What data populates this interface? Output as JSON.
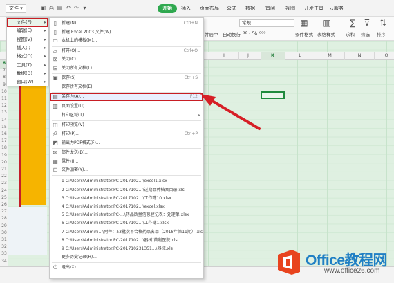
{
  "topbar": {
    "file_label": "文件",
    "tabs": [
      "开始",
      "插入",
      "页面布局",
      "公式",
      "数据",
      "审阅",
      "视图",
      "开发工具",
      "云服务"
    ]
  },
  "ribbon": {
    "number_format": "常规",
    "labels": [
      "并居中",
      "自动换行",
      "条件格式",
      "表格样式",
      "求和",
      "筛选",
      "排序"
    ]
  },
  "columns": [
    "I",
    "J",
    "K",
    "L",
    "M",
    "N",
    "O"
  ],
  "selected_column": "K",
  "rows": [
    "6",
    "7",
    "8",
    "9",
    "10",
    "11",
    "12",
    "13",
    "14",
    "15",
    "16",
    "17",
    "18",
    "19",
    "20",
    "21",
    "22",
    "23",
    "24",
    "25",
    "26",
    "27",
    "28",
    "29",
    "30",
    "31",
    "32",
    "33",
    "34"
  ],
  "selected_row": "6",
  "left_menu": {
    "items": [
      {
        "label": "文件(F)",
        "arrow": "▸"
      },
      {
        "label": "编辑(E)",
        "arrow": "▸"
      },
      {
        "label": "视图(V)",
        "arrow": "▸"
      },
      {
        "label": "插入(I)",
        "arrow": "▸"
      },
      {
        "label": "格式(O)",
        "arrow": "▸"
      },
      {
        "label": "工具(T)",
        "arrow": "▸"
      },
      {
        "label": "数据(D)",
        "arrow": "▸"
      },
      {
        "label": "窗口(W)",
        "arrow": "▸"
      }
    ]
  },
  "main_menu": {
    "items": [
      {
        "label": "新建(N)...",
        "shortcut": "Ctrl+N",
        "icon": "new-doc-icon"
      },
      {
        "label": "新建 Excel 2003 文件(W)",
        "shortcut": "",
        "icon": "new-doc-icon"
      },
      {
        "label": "本机上的模板(M)...",
        "shortcut": "",
        "icon": "template-icon"
      },
      {
        "label": "打开(O)...",
        "shortcut": "Ctrl+O",
        "icon": "open-folder-icon"
      },
      {
        "label": "关闭(C)",
        "shortcut": "",
        "icon": "close-doc-icon"
      },
      {
        "label": "关闭所有文档(L)",
        "shortcut": "",
        "icon": "close-all-icon"
      },
      {
        "label": "保存(S)",
        "shortcut": "Ctrl+S",
        "icon": "save-icon"
      },
      {
        "label": "保存所有文档(E)",
        "shortcut": "",
        "icon": ""
      },
      {
        "label": "另存为(A)...",
        "shortcut": "F12",
        "icon": "save-as-icon"
      },
      {
        "label": "页面设置(U)...",
        "shortcut": "",
        "icon": "page-setup-icon"
      },
      {
        "label": "打印区域(T)",
        "shortcut": "",
        "icon": "",
        "arrow": "▸"
      },
      {
        "label": "打印预览(V)",
        "shortcut": "",
        "icon": "print-preview-icon"
      },
      {
        "label": "打印(P)...",
        "shortcut": "Ctrl+P",
        "icon": "print-icon"
      },
      {
        "label": "输出为PDF格式(F)...",
        "shortcut": "",
        "icon": "pdf-icon"
      },
      {
        "label": "邮件发送(D)...",
        "shortcut": "",
        "icon": "mail-icon"
      },
      {
        "label": "属性(I)...",
        "shortcut": "",
        "icon": "properties-icon"
      },
      {
        "label": "文件加密(Y)...",
        "shortcut": "",
        "icon": "encrypt-icon"
      }
    ],
    "recent": [
      "1 C:\\Users\\Administrator.PC-2017102...\\excel1.xlsx",
      "2 C:\\Users\\Administrator.PC-2017102...\\过期品种档案目录.xls",
      "3 C:\\Users\\Administrator.PC-2017102...\\工作簿10.xlsx",
      "4 C:\\Users\\Administrator.PC-2017102...\\excel.xlsx",
      "5 C:\\Users\\Administrator.PC-...\\药品质量信息登记表：处理单.xlsx",
      "6 C:\\Users\\Administrator.PC-2017102...\\工作簿1.xlsx",
      "7 C:\\Users\\Admini...\\附件：53批次不合格药品名单（2018年第11期）.xls",
      "8 C:\\Users\\Administrator.PC-2017102...\\器械 首利医院.xls",
      "9 C:\\Users\\Administrator.PC-201710231351...\\器械.xls"
    ],
    "more": "更多历史记录(H)...",
    "exit": "退出(X)"
  },
  "logo": {
    "word1": "Office教程网",
    "word2": "www.office26.com",
    "brand_red": "#e8441e",
    "brand_blue": "#1f7fc4"
  },
  "colors": {
    "grid_bg": "#dff0e1",
    "accent_green": "#2fa84f",
    "highlight_red": "#c81e24",
    "yellow": "#f6b400"
  }
}
